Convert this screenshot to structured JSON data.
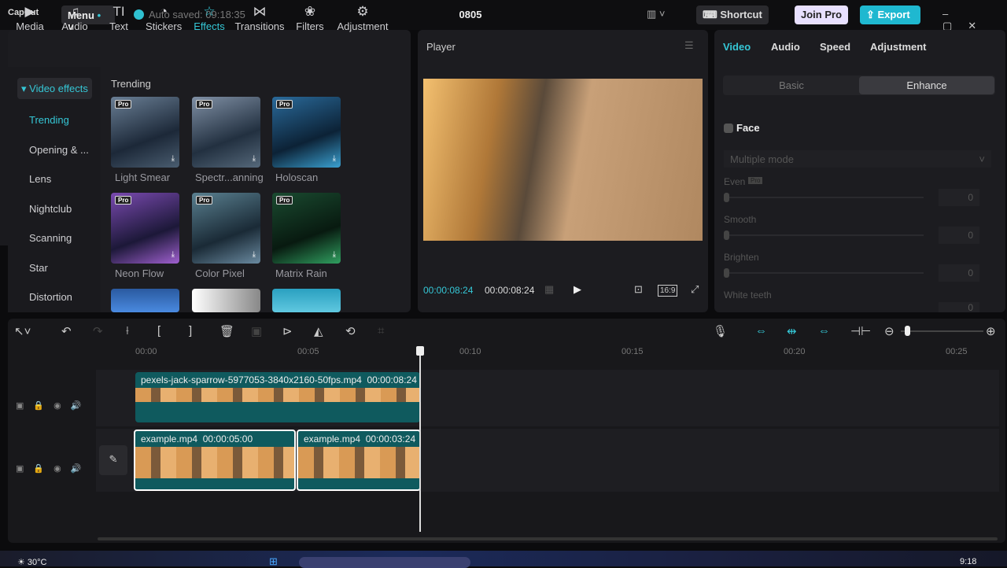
{
  "titlebar": {
    "logo": "CapCut",
    "menu": "Menu",
    "autosave": "Auto saved: 09:18:35",
    "project": "0805",
    "shortcut": "Shortcut",
    "join_pro": "Join Pro",
    "export": "Export"
  },
  "toolbar_tabs": [
    {
      "icon": "▶",
      "label": "Media"
    },
    {
      "icon": "♫",
      "label": "Audio"
    },
    {
      "icon": "TI",
      "label": "Text"
    },
    {
      "icon": "◔",
      "label": "Stickers"
    },
    {
      "icon": "☆",
      "label": "Effects"
    },
    {
      "icon": "⋈",
      "label": "Transitions"
    },
    {
      "icon": "❀",
      "label": "Filters"
    },
    {
      "icon": "⚙",
      "label": "Adjustment"
    }
  ],
  "sidebar": {
    "header": "▾ Video effects",
    "items": [
      "Trending",
      "Opening & ...",
      "Lens",
      "Nightclub",
      "Scanning",
      "Star",
      "Distortion"
    ]
  },
  "effects": {
    "section": "Trending",
    "items": [
      {
        "name": "Light Smear",
        "pro": "Pro"
      },
      {
        "name": "Spectr...anning",
        "pro": "Pro"
      },
      {
        "name": "Holoscan",
        "pro": "Pro"
      },
      {
        "name": "Neon Flow",
        "pro": "Pro"
      },
      {
        "name": "Color Pixel",
        "pro": "Pro"
      },
      {
        "name": "Matrix Rain",
        "pro": "Pro"
      }
    ]
  },
  "player": {
    "title": "Player",
    "current_time": "00:00:08:24",
    "total_time": "00:00:08:24",
    "ratio": "16:9"
  },
  "inspector": {
    "tabs": [
      "Video",
      "Audio",
      "Speed",
      "Adjustment"
    ],
    "subtabs": [
      "Basic",
      "Enhance"
    ],
    "section": "Face",
    "mode": "Multiple mode",
    "pro_badge": "Pro",
    "sliders": [
      {
        "label": "Even",
        "value": "0"
      },
      {
        "label": "Smooth",
        "value": "0"
      },
      {
        "label": "Brighten",
        "value": "0"
      },
      {
        "label": "White teeth",
        "value": "0"
      }
    ]
  },
  "timeline": {
    "ruler": [
      "00:00",
      "00:05",
      "00:10",
      "00:15",
      "00:20",
      "00:25"
    ],
    "track1": {
      "name": "pexels-jack-sparrow-5977053-3840x2160-50fps.mp4",
      "duration": "00:00:08:24"
    },
    "track2": [
      {
        "name": "example.mp4",
        "duration": "00:00:05:00"
      },
      {
        "name": "example.mp4",
        "duration": "00:00:03:24"
      }
    ]
  },
  "taskbar": {
    "weather": "30°C",
    "time": "9:18"
  }
}
